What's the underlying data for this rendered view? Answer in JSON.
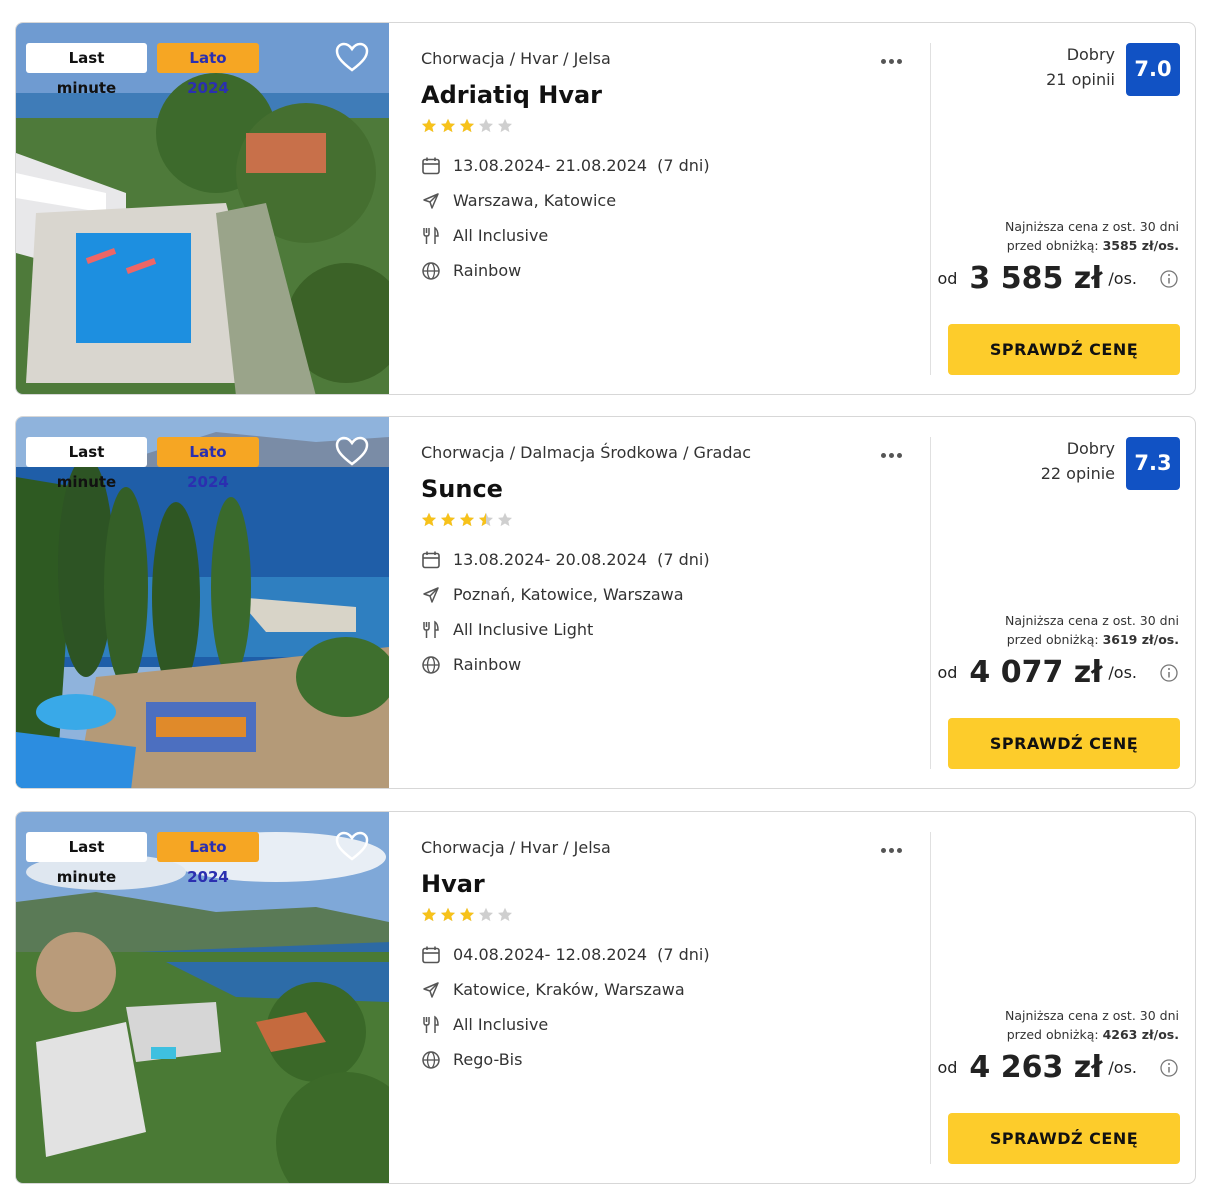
{
  "colors": {
    "rating_blue": "#1152c4",
    "cta_yellow": "#fdcc2b",
    "badge_orange": "#f6a623",
    "star_gold": "#f7c21a",
    "star_grey": "#cfcfcf"
  },
  "icons": {
    "favorite": "heart-outline-icon",
    "more": "more-horizontal-icon",
    "dates": "calendar-icon",
    "flight": "plane-icon",
    "board": "cutlery-icon",
    "operator": "globe-icon",
    "info": "info-circle-icon"
  },
  "offers": [
    {
      "badges": {
        "last_minute": "Last minute",
        "season": "Lato 2024"
      },
      "location": "Chorwacja / Hvar / Jelsa",
      "name": "Adriatiq Hvar",
      "stars": 3,
      "dates": "13.08.2024- 21.08.2024",
      "duration": "(7 dni)",
      "departures": "Warszawa, Katowice",
      "board": "All Inclusive",
      "operator": "Rainbow",
      "rating": {
        "label": "Dobry",
        "count": "21 opinii",
        "score": "7.0"
      },
      "lowest_price": {
        "line1": "Najniższa cena z ost. 30 dni",
        "line2": "przed obniżką:",
        "value": "3585 zł/os."
      },
      "price": {
        "prefix": "od",
        "amount": "3 585 zł",
        "per": "/os."
      },
      "cta": "SPRAWDŹ CENĘ"
    },
    {
      "badges": {
        "last_minute": "Last minute",
        "season": "Lato 2024"
      },
      "location": "Chorwacja / Dalmacja Środkowa / Gradac",
      "name": "Sunce",
      "stars": 3.5,
      "dates": "13.08.2024- 20.08.2024",
      "duration": "(7 dni)",
      "departures": "Poznań, Katowice, Warszawa",
      "board": "All Inclusive Light",
      "operator": "Rainbow",
      "rating": {
        "label": "Dobry",
        "count": "22 opinie",
        "score": "7.3"
      },
      "lowest_price": {
        "line1": "Najniższa cena z ost. 30 dni",
        "line2": "przed obniżką:",
        "value": "3619 zł/os."
      },
      "price": {
        "prefix": "od",
        "amount": "4 077 zł",
        "per": "/os."
      },
      "cta": "SPRAWDŹ CENĘ"
    },
    {
      "badges": {
        "last_minute": "Last minute",
        "season": "Lato 2024"
      },
      "location": "Chorwacja / Hvar / Jelsa",
      "name": "Hvar",
      "stars": 3,
      "dates": "04.08.2024- 12.08.2024",
      "duration": "(7 dni)",
      "departures": "Katowice, Kraków, Warszawa",
      "board": "All Inclusive",
      "operator": "Rego-Bis",
      "rating": null,
      "lowest_price": {
        "line1": "Najniższa cena z ost. 30 dni",
        "line2": "przed obniżką:",
        "value": "4263 zł/os."
      },
      "price": {
        "prefix": "od",
        "amount": "4 263 zł",
        "per": "/os."
      },
      "cta": "SPRAWDŹ CENĘ"
    }
  ]
}
